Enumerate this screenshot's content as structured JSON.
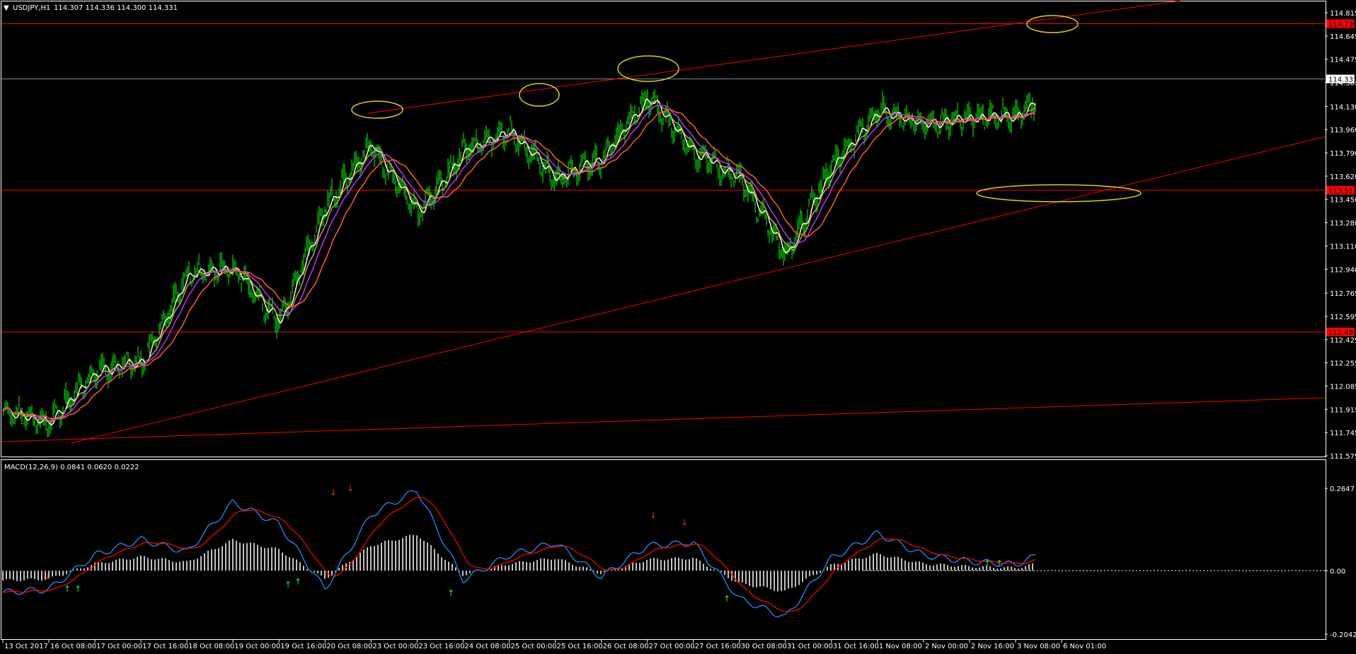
{
  "window": {
    "symbol_label": "USDJPY,H1",
    "ohlc_label": "114.307 114.336 114.300 114.331"
  },
  "price_panel": {
    "y_ticks": [
      "114.815",
      "114.645",
      "114.475",
      "114.305",
      "114.130",
      "113.960",
      "113.790",
      "113.620",
      "113.450",
      "113.280",
      "113.110",
      "112.940",
      "112.765",
      "112.595",
      "112.425",
      "112.255",
      "112.085",
      "111.915",
      "111.745",
      "111.575"
    ],
    "current_price_tag": "114.331",
    "level_tags": [
      "114.735",
      "113.517",
      "112.481"
    ]
  },
  "macd_panel": {
    "label": "MACD(12,26,9) 0.0841 0.0620 0.0222",
    "y_ticks": [
      "0.2647",
      "0.00",
      "-0.2042"
    ]
  },
  "x_ticks": [
    "13 Oct 2017",
    "16 Oct 08:00",
    "17 Oct 00:00",
    "17 Oct 16:00",
    "18 Oct 08:00",
    "19 Oct 00:00",
    "19 Oct 16:00",
    "20 Oct 08:00",
    "23 Oct 00:00",
    "23 Oct 16:00",
    "24 Oct 08:00",
    "25 Oct 00:00",
    "25 Oct 16:00",
    "26 Oct 08:00",
    "27 Oct 00:00",
    "27 Oct 16:00",
    "30 Oct 08:00",
    "31 Oct 00:00",
    "31 Oct 16:00",
    "1 Nov 08:00",
    "2 Nov 00:00",
    "2 Nov 16:00",
    "3 Nov 08:00",
    "6 Nov 01:00"
  ],
  "colors": {
    "background": "#000000",
    "candles": "#00ff00",
    "level_lines": "#ff0000",
    "trend_lines": "#ff0000",
    "current_price_line": "#6e8ca0",
    "ellipses": "#e0d000",
    "ma_fast": "#fffacd",
    "ma_mid": "#b0a060",
    "ma_slow1": "#c030ff",
    "ma_slow2": "#ff6020",
    "macd_main": "#1e90ff",
    "macd_signal": "#ff0000",
    "macd_hist": "#c0c0c0",
    "axis_text": "#ffffff"
  },
  "chart_data": {
    "type": "candlestick",
    "symbol": "USDJPY",
    "timeframe": "H1",
    "current_close": 114.331,
    "last_bar": {
      "open": 114.307,
      "high": 114.336,
      "low": 114.3,
      "close": 114.331
    },
    "ylim": [
      111.575,
      114.815
    ],
    "horizontal_levels": [
      114.735,
      113.517,
      112.481,
      114.331
    ],
    "close_path": [
      {
        "x": "13 Oct 2017",
        "y": 111.9
      },
      {
        "x": "16 Oct 08:00",
        "y": 111.82
      },
      {
        "x": "17 Oct 00:00",
        "y": 112.2
      },
      {
        "x": "17 Oct 16:00",
        "y": 112.25
      },
      {
        "x": "18 Oct 08:00",
        "y": 112.9
      },
      {
        "x": "19 Oct 00:00",
        "y": 112.95
      },
      {
        "x": "19 Oct 16:00",
        "y": 112.55
      },
      {
        "x": "20 Oct 08:00",
        "y": 113.4
      },
      {
        "x": "23 Oct 00:00",
        "y": 113.85
      },
      {
        "x": "23 Oct 16:00",
        "y": 113.35
      },
      {
        "x": "24 Oct 08:00",
        "y": 113.8
      },
      {
        "x": "25 Oct 00:00",
        "y": 113.95
      },
      {
        "x": "25 Oct 16:00",
        "y": 113.6
      },
      {
        "x": "26 Oct 08:00",
        "y": 113.75
      },
      {
        "x": "27 Oct 00:00",
        "y": 114.2
      },
      {
        "x": "27 Oct 16:00",
        "y": 113.8
      },
      {
        "x": "30 Oct 08:00",
        "y": 113.6
      },
      {
        "x": "31 Oct 00:00",
        "y": 113.05
      },
      {
        "x": "31 Oct 16:00",
        "y": 113.7
      },
      {
        "x": "1 Nov 08:00",
        "y": 114.1
      },
      {
        "x": "2 Nov 00:00",
        "y": 114.0
      },
      {
        "x": "2 Nov 16:00",
        "y": 114.05
      },
      {
        "x": "3 Nov 08:00",
        "y": 114.05
      },
      {
        "x": "6 Nov 01:00",
        "y": 114.331
      }
    ],
    "macd": {
      "params": "12,26,9",
      "main": 0.0841,
      "signal": 0.062,
      "histogram": 0.0222,
      "ylim": [
        -0.2042,
        0.2647
      ],
      "main_path": [
        -0.07,
        -0.06,
        0.05,
        0.1,
        0.06,
        0.22,
        0.15,
        -0.06,
        0.18,
        0.26,
        -0.03,
        0.05,
        0.09,
        -0.02,
        0.08,
        0.09,
        -0.09,
        -0.15,
        0.04,
        0.12,
        0.05,
        0.03,
        0.02,
        0.08
      ]
    }
  }
}
